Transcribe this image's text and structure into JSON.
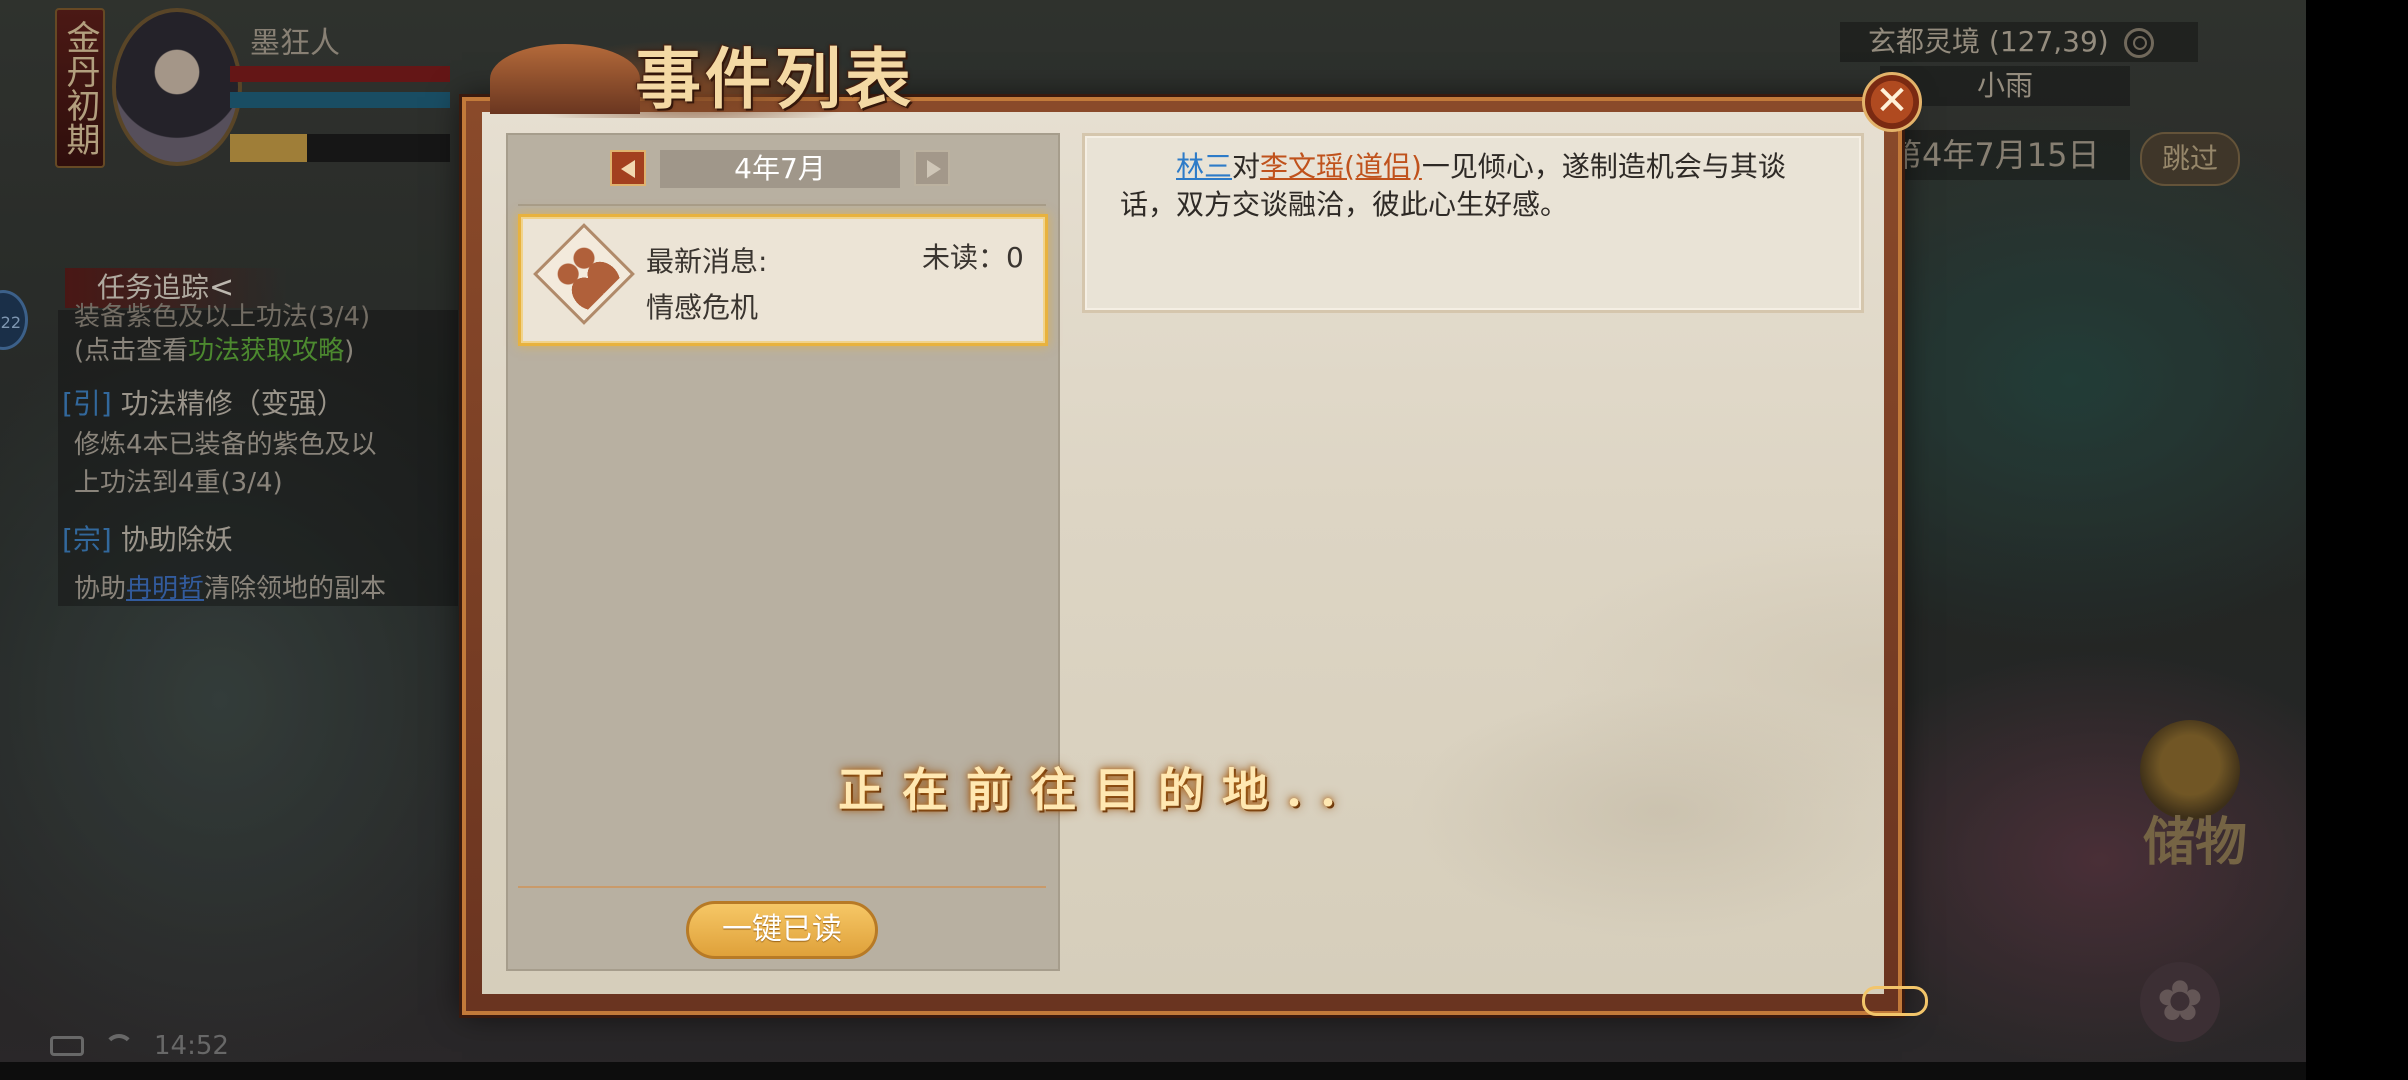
{
  "player": {
    "realm": "金丹初期",
    "name": "墨狂人",
    "exp_fraction": 0.35
  },
  "tasks": {
    "header": "任务追踪",
    "chevron": "<",
    "side_tab": "22",
    "line1": "装备紫色及以上功法(3/4)",
    "line2_prefix": "(点击查看",
    "line2_link": "功法获取攻略",
    "line2_suffix": ")",
    "q2_tag": "[引]",
    "q2_title": "功法精修（变强）",
    "q2_desc1": "修炼4本已装备的紫色及以",
    "q2_desc2": "上功法到4重(3/4)",
    "q3_tag": "[宗]",
    "q3_title": "协助除妖",
    "q3_prefix": "协助",
    "q3_link": "冉明哲",
    "q3_suffix": "清除领地的副本"
  },
  "status_bar": {
    "time": "14:52"
  },
  "hud": {
    "location": "玄都灵境 (127,39)",
    "weather": "小雨",
    "date": "第4年7月15日",
    "skip": "跳过",
    "storage": "储物"
  },
  "dialog": {
    "title": "事件列表",
    "close_symbol": "✕",
    "month": "4年7月",
    "event": {
      "latest_label": "最新消息:",
      "unread": "未读：0",
      "name": "情感危机"
    },
    "read_all": "一键已读",
    "detail": {
      "name1": "林三",
      "mid1": "对",
      "name2": "李文瑶(道侣)",
      "rest": "一见倾心，遂制造机会与其谈话，双方交谈融洽，彼此心生好感。"
    }
  },
  "travel_message": "正在前往目的地.."
}
